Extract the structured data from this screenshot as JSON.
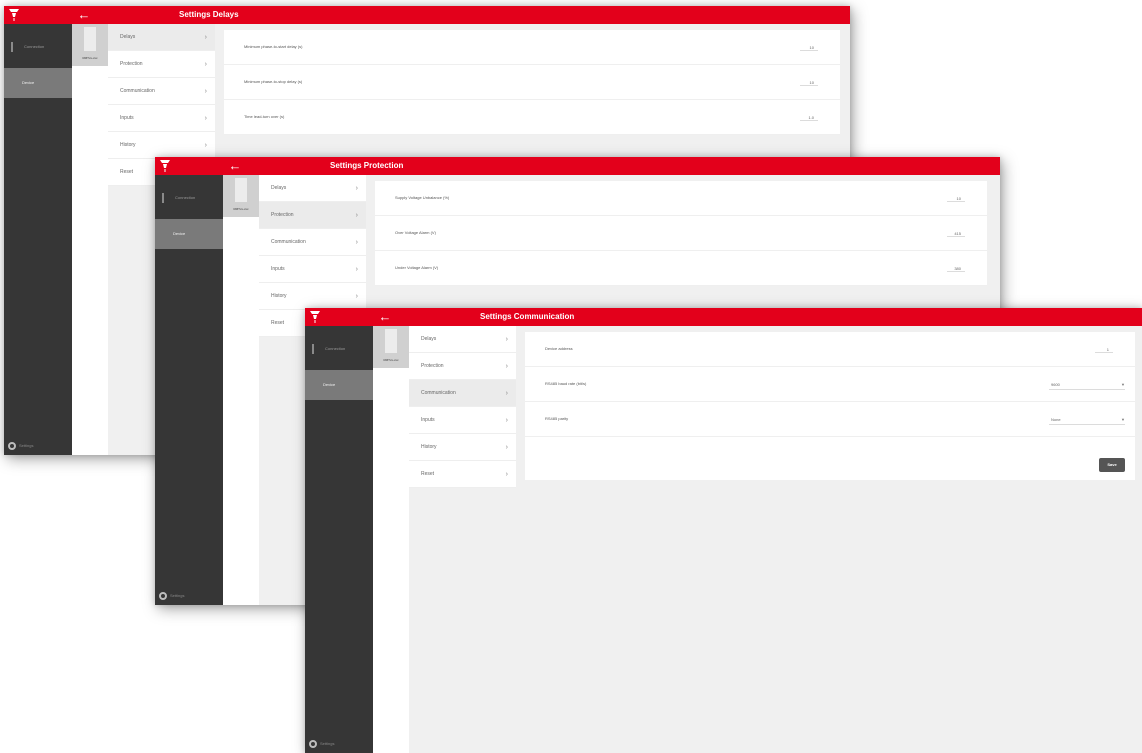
{
  "colors": {
    "accent": "#e3001b",
    "sidebar": "#363636",
    "sidebar_active": "#7a7a7a"
  },
  "windows": [
    {
      "title": "Settings  Delays",
      "sidebar": {
        "items": [
          "Connection",
          "Device"
        ],
        "footer": "Settings"
      },
      "device_label": "RMTxx-xxx",
      "menu": [
        "Delays",
        "Protection",
        "Communication",
        "Inputs",
        "History",
        "Reset"
      ],
      "active_menu_index": 0,
      "settings": [
        {
          "label": "Minimum phase-to-start delay (s)",
          "value": "10"
        },
        {
          "label": "Minimum phase-to-stop delay (s)",
          "value": "10"
        },
        {
          "label": "Time lead-turn over (s)",
          "value": "1.0"
        }
      ]
    },
    {
      "title": "Settings  Protection",
      "sidebar": {
        "items": [
          "Connection",
          "Device"
        ],
        "footer": "Settings"
      },
      "device_label": "RMTxx-xxx",
      "menu": [
        "Delays",
        "Protection",
        "Communication",
        "Inputs",
        "History",
        "Reset"
      ],
      "active_menu_index": 1,
      "settings": [
        {
          "label": "Supply Voltage Unbalance (%)",
          "value": "10"
        },
        {
          "label": "Over Voltage Alarm (V)",
          "value": "415"
        },
        {
          "label": "Under Voltage Alarm (V)",
          "value": "380"
        }
      ]
    },
    {
      "title": "Settings  Communication",
      "sidebar": {
        "items": [
          "Connection",
          "Device"
        ],
        "footer": "Settings"
      },
      "device_label": "RMTxx-xxx",
      "menu": [
        "Delays",
        "Protection",
        "Communication",
        "Inputs",
        "History",
        "Reset"
      ],
      "active_menu_index": 2,
      "settings": [
        {
          "label": "Device address",
          "value": "1"
        },
        {
          "label": "RS485 baud rate (bit/s)",
          "select": "9600"
        },
        {
          "label": "RS485 parity",
          "select": "None"
        }
      ],
      "save_label": "Save"
    }
  ]
}
